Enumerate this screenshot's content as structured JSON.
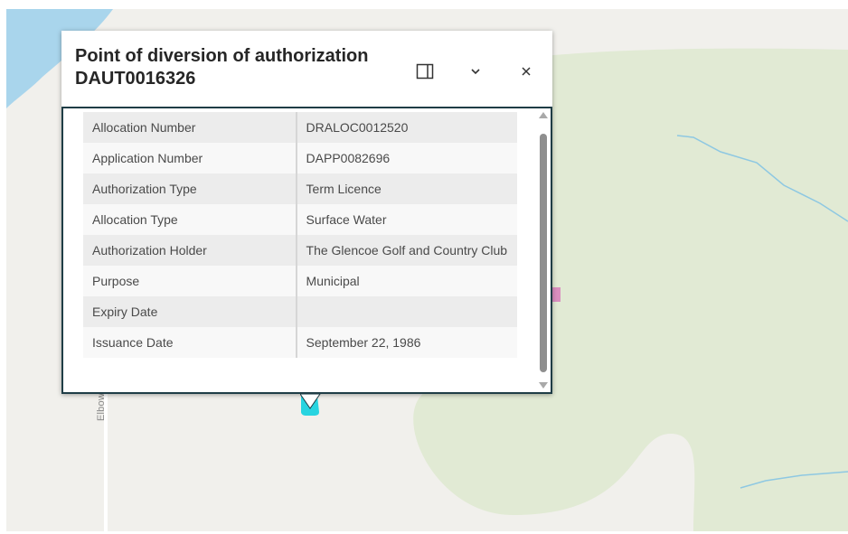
{
  "popup": {
    "title": "Point of diversion of authorization DAUT0016326",
    "dock_icon": "dock-panel-icon",
    "collapse_icon": "chevron-down-icon",
    "close_icon": "close-icon"
  },
  "attributes": [
    {
      "key": "Allocation Number",
      "value": "DRALOC0012520"
    },
    {
      "key": "Application Number",
      "value": "DAPP0082696"
    },
    {
      "key": "Authorization Type",
      "value": "Term Licence"
    },
    {
      "key": "Allocation Type",
      "value": "Surface Water"
    },
    {
      "key": "Authorization Holder",
      "value": "The Glencoe Golf and Country Club"
    },
    {
      "key": "Purpose",
      "value": "Municipal"
    },
    {
      "key": "Expiry Date",
      "value": ""
    },
    {
      "key": "Issuance Date",
      "value": "September 22, 1986"
    }
  ],
  "map": {
    "road_label": "Elbow River Pt",
    "colors": {
      "background": "#f1f0ec",
      "park": "#e1ead4",
      "water": "#a9d5ec",
      "stream": "#8ec8e2",
      "marker": "#28d4e0",
      "accent_border": "#1f3d46"
    }
  }
}
